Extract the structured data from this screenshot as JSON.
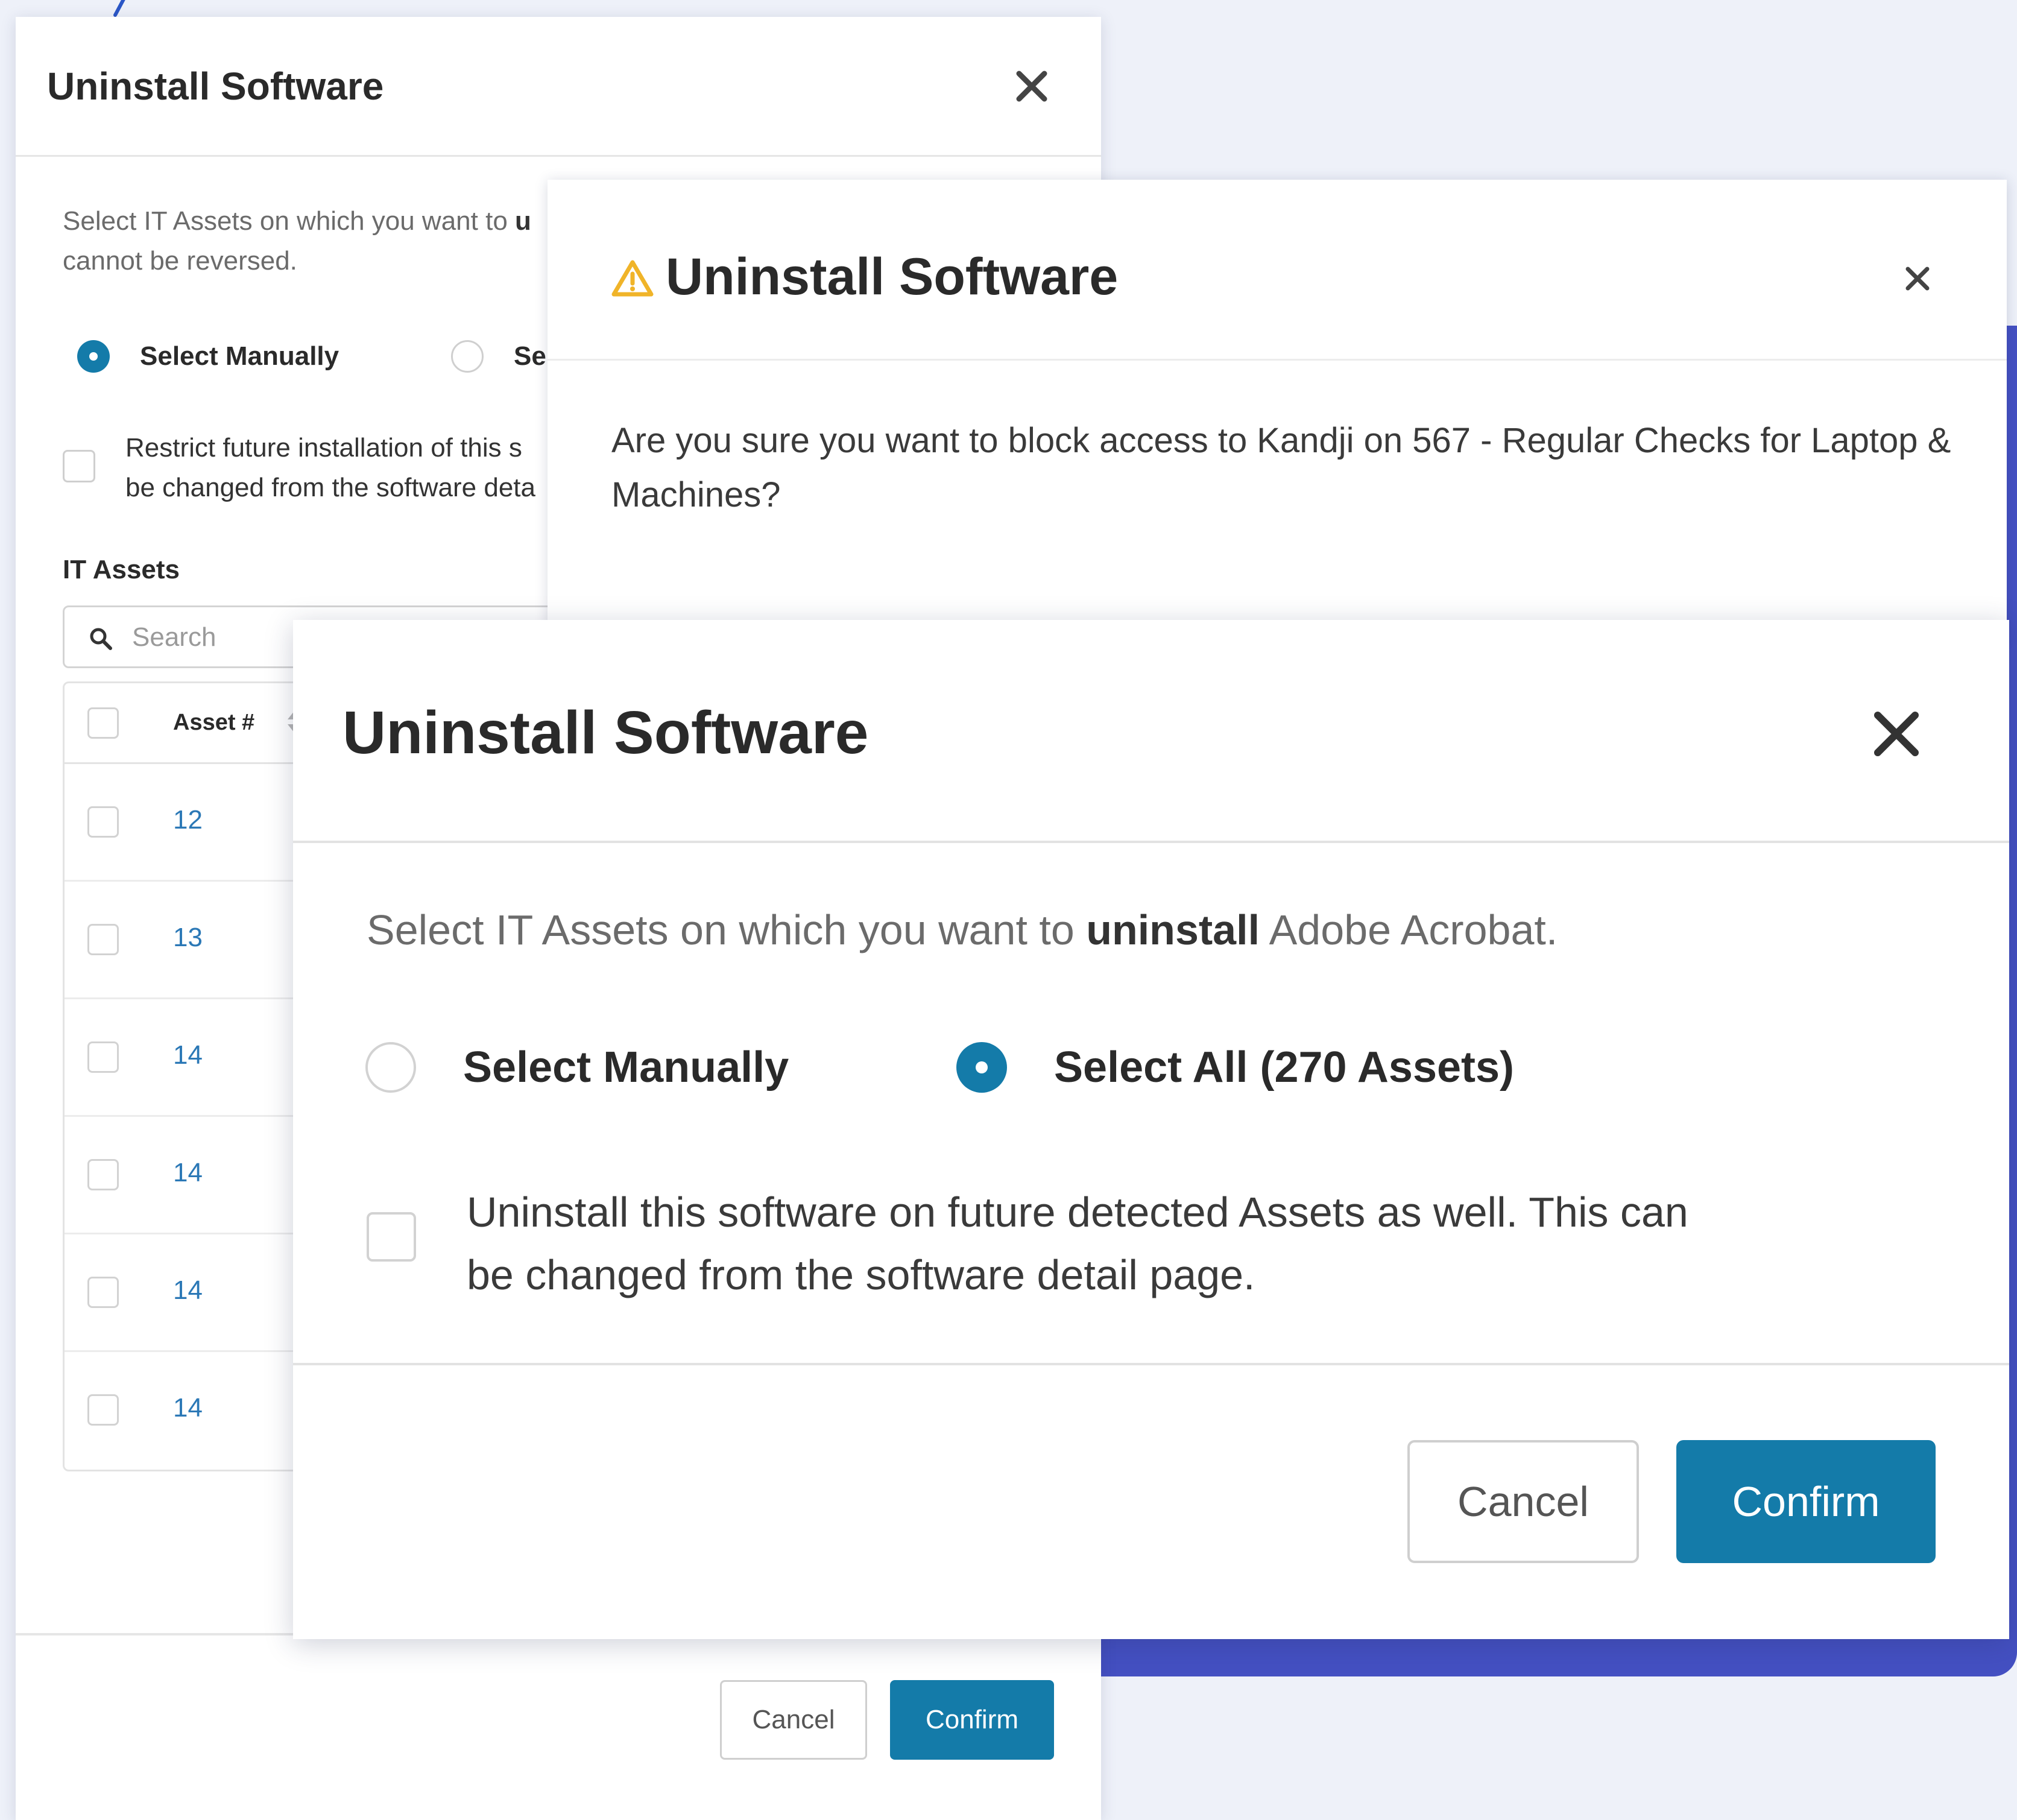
{
  "colors": {
    "accent": "#147ba9",
    "link": "#2b78b6",
    "warning": "#f0b429",
    "backdrop_purple": "#4450c2"
  },
  "back_modal": {
    "title": "Uninstall Software",
    "close_icon": "close-icon",
    "description_prefix": "Select IT Assets on which you want to ",
    "description_bold": "u",
    "description_suffix": "cannot be reversed.",
    "radio_manual_label": "Select Manually",
    "radio_all_label": "Sele",
    "restrict_text_line1": "Restrict future installation of this s",
    "restrict_text_line2": "be changed from the software deta",
    "section_label": "IT Assets",
    "search_placeholder": "Search",
    "search_icon": "search-icon",
    "table_header_asset": "Asset #",
    "rows": [
      "12",
      "13",
      "14",
      "14",
      "14",
      "14"
    ],
    "cancel_label": "Cancel",
    "confirm_label": "Confirm"
  },
  "warning_modal": {
    "title": "Uninstall Software",
    "warning_icon": "warning-icon",
    "question": "Are you sure you want to block access to Kandji on 567 - Regular Checks for Laptop & Machines?"
  },
  "front_modal": {
    "title": "Uninstall Software",
    "description_prefix": "Select IT Assets on which you want to ",
    "description_bold": "uninstall",
    "description_suffix": " Adobe Acrobat.",
    "radio_manual_label": "Select Manually",
    "radio_all_label": "Select All (270 Assets)",
    "selected_option": "Select All (270 Assets)",
    "future_text": "Uninstall this software on future detected Assets as well. This can be changed from the software detail page.",
    "cancel_label": "Cancel",
    "confirm_label": "Confirm"
  }
}
